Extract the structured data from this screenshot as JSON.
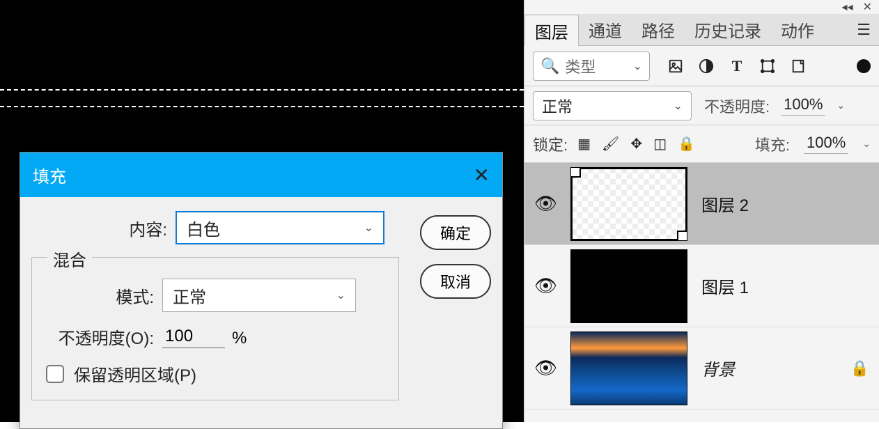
{
  "dialog": {
    "title": "填充",
    "content_label": "内容:",
    "content_value": "白色",
    "ok": "确定",
    "cancel": "取消",
    "blend": {
      "legend": "混合",
      "mode_label": "模式:",
      "mode_value": "正常",
      "opacity_label": "不透明度(O):",
      "opacity_value": "100",
      "opacity_unit": "%",
      "preserve_label": "保留透明区域(P)"
    }
  },
  "panel": {
    "tabs": {
      "layers": "图层",
      "channels": "通道",
      "paths": "路径",
      "history": "历史记录",
      "actions": "动作"
    },
    "type_filter": {
      "icon": "🔍",
      "label": "类型"
    },
    "blend_mode": "正常",
    "opacity": {
      "label": "不透明度:",
      "value": "100%"
    },
    "lock_label": "锁定:",
    "fill": {
      "label": "填充:",
      "value": "100%"
    },
    "layers": [
      {
        "name": "图层 2"
      },
      {
        "name": "图层 1"
      },
      {
        "name": "背景"
      }
    ]
  }
}
